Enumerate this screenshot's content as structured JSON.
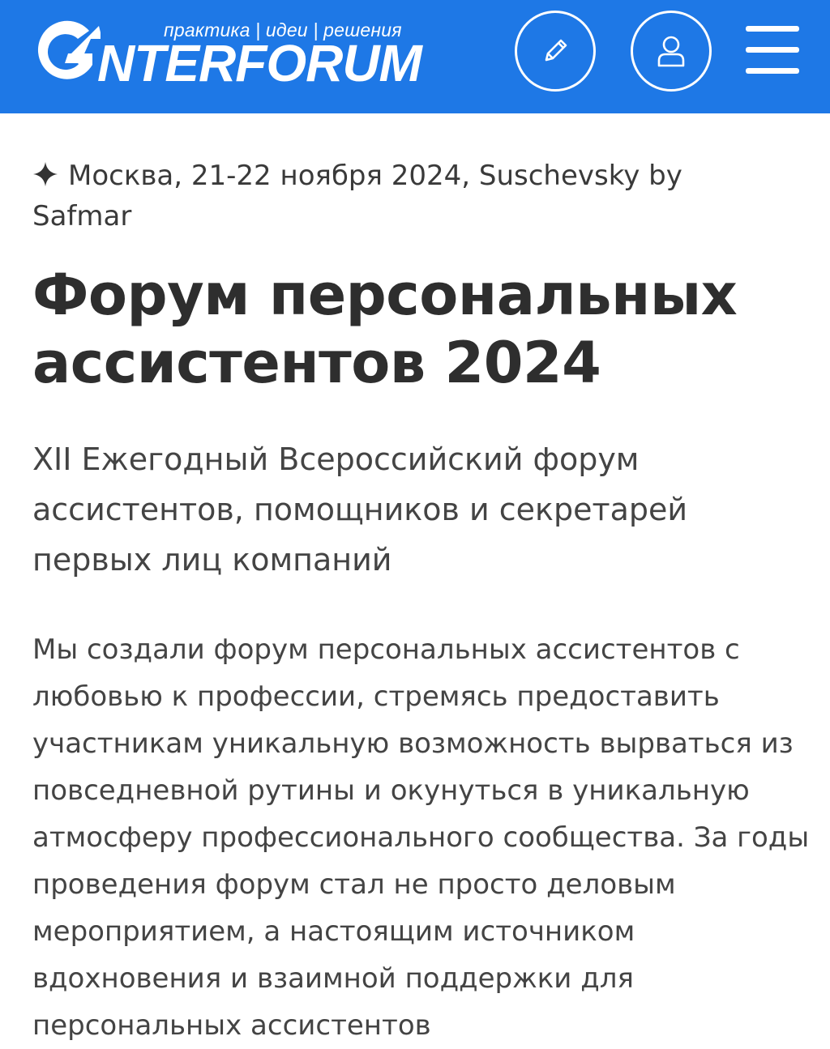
{
  "header": {
    "logo_tagline": "практика | идеи | решения",
    "logo_wordmark": "NTERFORUM",
    "logo_initial": "G",
    "edit_icon": "pencil-icon",
    "user_icon": "user-icon",
    "menu_icon": "hamburger-icon",
    "brand_color": "#1e78e6"
  },
  "event": {
    "meta": "Москва, 21-22 ноября 2024, Suschevsky by Safmar",
    "meta_icon": "sparkle-icon",
    "title": "Форум персональных ассистентов 2024",
    "subtitle": "XII Ежегодный Всероссийский форум ассистентов, помощников и секретарей первых лиц компаний",
    "description": "Мы создали форум персональных ассистентов с любовью к профессии, стремясь предоставить участникам уникальную возможность вырваться из повседневной рутины и окунуться в уникальную атмосферу профессионального сообщества. За годы проведения форум стал не просто деловым мероприятием, а настоящим источником вдохновения и взаимной поддержки для персональных ассистентов"
  }
}
